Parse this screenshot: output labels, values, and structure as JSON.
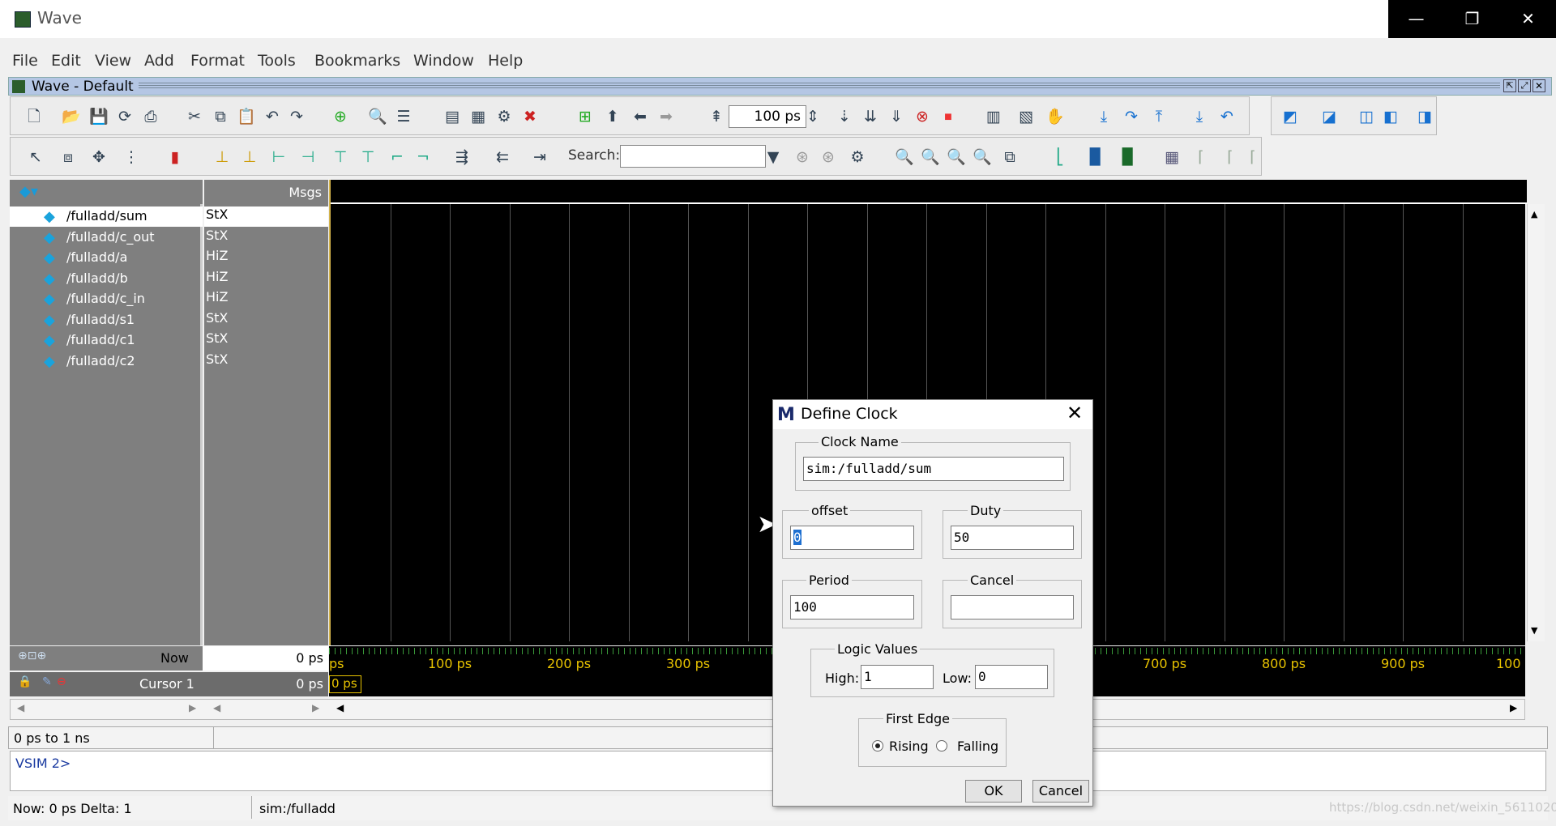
{
  "window": {
    "title": "Wave",
    "minimize_icon": "minimize-icon",
    "restore_icon": "restore-icon",
    "close_icon": "close-icon"
  },
  "menu": [
    "File",
    "Edit",
    "View",
    "Add",
    "Format",
    "Tools",
    "Bookmarks",
    "Window",
    "Help"
  ],
  "wave_header": {
    "title": "Wave - Default"
  },
  "toolbar": {
    "time_value": "100 ps",
    "search_label": "Search:",
    "search_value": ""
  },
  "panes": {
    "msgs_header": "Msgs",
    "signals": [
      {
        "name": "/fulladd/sum",
        "value": "StX"
      },
      {
        "name": "/fulladd/c_out",
        "value": "StX"
      },
      {
        "name": "/fulladd/a",
        "value": "HiZ"
      },
      {
        "name": "/fulladd/b",
        "value": "HiZ"
      },
      {
        "name": "/fulladd/c_in",
        "value": "HiZ"
      },
      {
        "name": "/fulladd/s1",
        "value": "StX"
      },
      {
        "name": "/fulladd/c1",
        "value": "StX"
      },
      {
        "name": "/fulladd/c2",
        "value": "StX"
      }
    ],
    "now_label": "Now",
    "now_value": "0 ps",
    "cursor_label": "Cursor 1",
    "cursor_value": "0 ps",
    "cursor_flag": "0 ps"
  },
  "ruler": {
    "ticks": [
      "ps",
      "100 ps",
      "200 ps",
      "300 ps",
      "700 ps",
      "800 ps",
      "900 ps",
      "100"
    ]
  },
  "status": {
    "range": "0 ps to 1 ns",
    "prompt": "VSIM 2>",
    "now_delta": "Now: 0 ps  Delta: 1",
    "context": "sim:/fulladd"
  },
  "watermark": "https://blog.csdn.net/weixin_5611020",
  "dialog": {
    "title": "Define Clock",
    "clock_name_label": "Clock Name",
    "clock_name_value": "sim:/fulladd/sum",
    "offset_label": "offset",
    "offset_value": "0",
    "duty_label": "Duty",
    "duty_value": "50",
    "period_label": "Period",
    "period_value": "100",
    "cancel_label": "Cancel",
    "cancel_value": "",
    "logic_values_label": "Logic Values",
    "high_label": "High:",
    "high_value": "1",
    "low_label": "Low:",
    "low_value": "0",
    "first_edge_label": "First Edge",
    "rising_label": "Rising",
    "falling_label": "Falling",
    "first_edge_selected": "Rising",
    "ok_button": "OK",
    "cancel_button": "Cancel"
  }
}
